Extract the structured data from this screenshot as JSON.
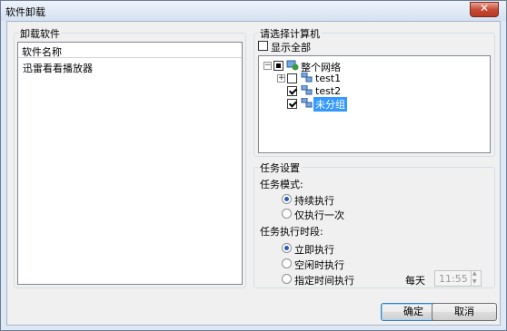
{
  "window": {
    "title": "软件卸载"
  },
  "uninstall": {
    "group_label": "卸载软件",
    "column_header": "软件名称",
    "items": [
      "迅雷看看播放器"
    ]
  },
  "select_computer": {
    "group_label": "请选择计算机",
    "show_all_label": "显示全部",
    "tree": {
      "root": "整个网络",
      "children": [
        "test1",
        "test2",
        "未分组"
      ]
    }
  },
  "task_settings": {
    "group_label": "任务设置",
    "mode_label": "任务模式:",
    "mode_options": [
      "持续执行",
      "仅执行一次"
    ],
    "mode_selected": "持续执行",
    "time_label": "任务执行时段:",
    "time_options": [
      "立即执行",
      "空闲时执行",
      "指定时间执行"
    ],
    "time_selected": "立即执行",
    "daily_label": "每天",
    "time_value": "11:55"
  },
  "buttons": {
    "ok": "确定",
    "cancel": "取消"
  },
  "colors": {
    "selection": "#3399ff",
    "accent": "#2a5caa"
  }
}
